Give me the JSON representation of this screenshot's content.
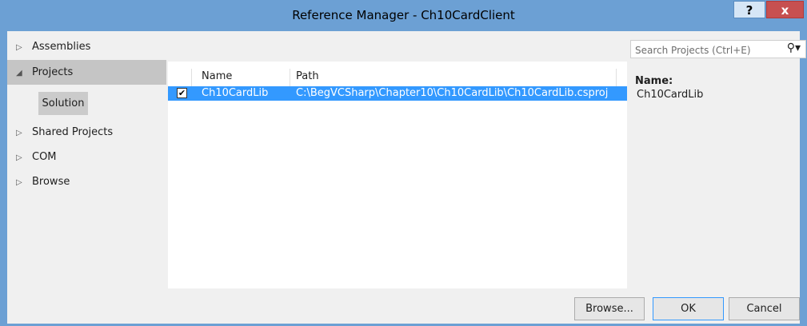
{
  "window": {
    "title": "Reference Manager - Ch10CardClient",
    "help_label": "?",
    "close_label": "x"
  },
  "nav": {
    "items": [
      {
        "label": "Assemblies",
        "arrow": "▷",
        "selected": false
      },
      {
        "label": "Projects",
        "arrow": "◢",
        "selected": true
      },
      {
        "label": "Shared Projects",
        "arrow": "▷",
        "selected": false
      },
      {
        "label": "COM",
        "arrow": "▷",
        "selected": false
      },
      {
        "label": "Browse",
        "arrow": "▷",
        "selected": false
      }
    ],
    "sub_item": "Solution"
  },
  "list": {
    "columns": [
      "Name",
      "Path"
    ],
    "rows": [
      {
        "checked": true,
        "name": "Ch10CardLib",
        "path": "C:\\BegVCSharp\\Chapter10\\Ch10CardLib\\Ch10CardLib.csproj"
      }
    ]
  },
  "search": {
    "placeholder": "Search Projects (Ctrl+E)",
    "icon": "search-icon"
  },
  "details": {
    "label": "Name:",
    "value": "Ch10CardLib"
  },
  "footer": {
    "browse_label": "Browse...",
    "ok_label": "OK",
    "cancel_label": "Cancel"
  },
  "colors": {
    "title_bar": "#6ca0d4",
    "selection": "#3399ff",
    "close_button": "#c75050"
  }
}
